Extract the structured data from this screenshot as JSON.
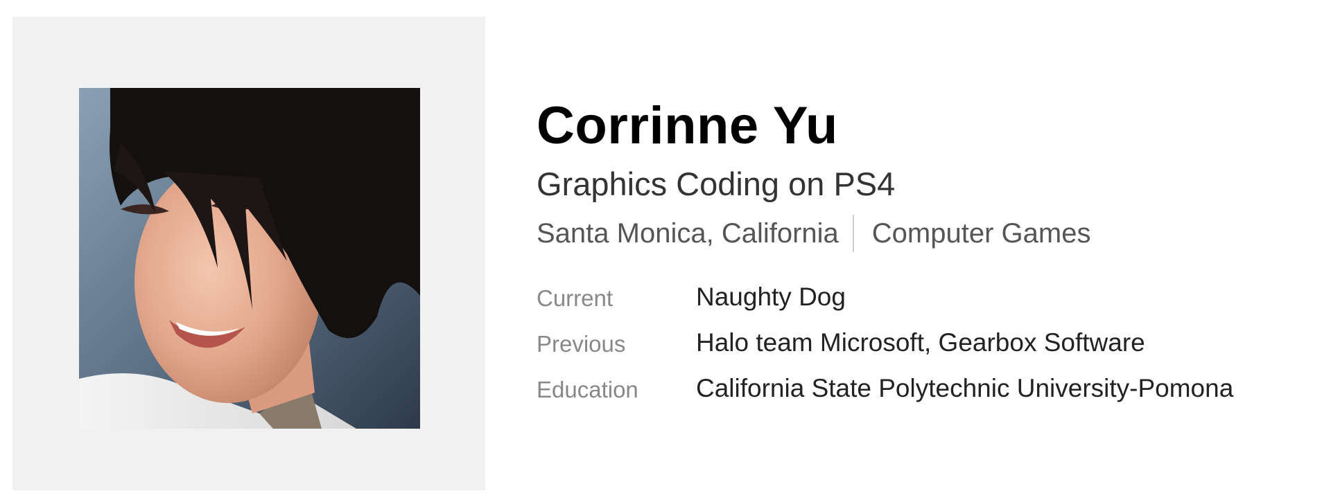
{
  "profile": {
    "photo_alt": "Profile photo",
    "name": "Corrinne Yu",
    "headline": "Graphics Coding on PS4",
    "location": "Santa Monica, California",
    "industry": "Computer Games",
    "details": [
      {
        "label": "Current",
        "value": "Naughty Dog"
      },
      {
        "label": "Previous",
        "value": "Halo team Microsoft, Gearbox Software"
      },
      {
        "label": "Education",
        "value": "California State Polytechnic University-Pomona"
      }
    ]
  },
  "colors": {
    "panel_background": "#f1f1f1",
    "name_text": "#000000",
    "label_text": "#888888",
    "separator": "#cfcfcf"
  }
}
